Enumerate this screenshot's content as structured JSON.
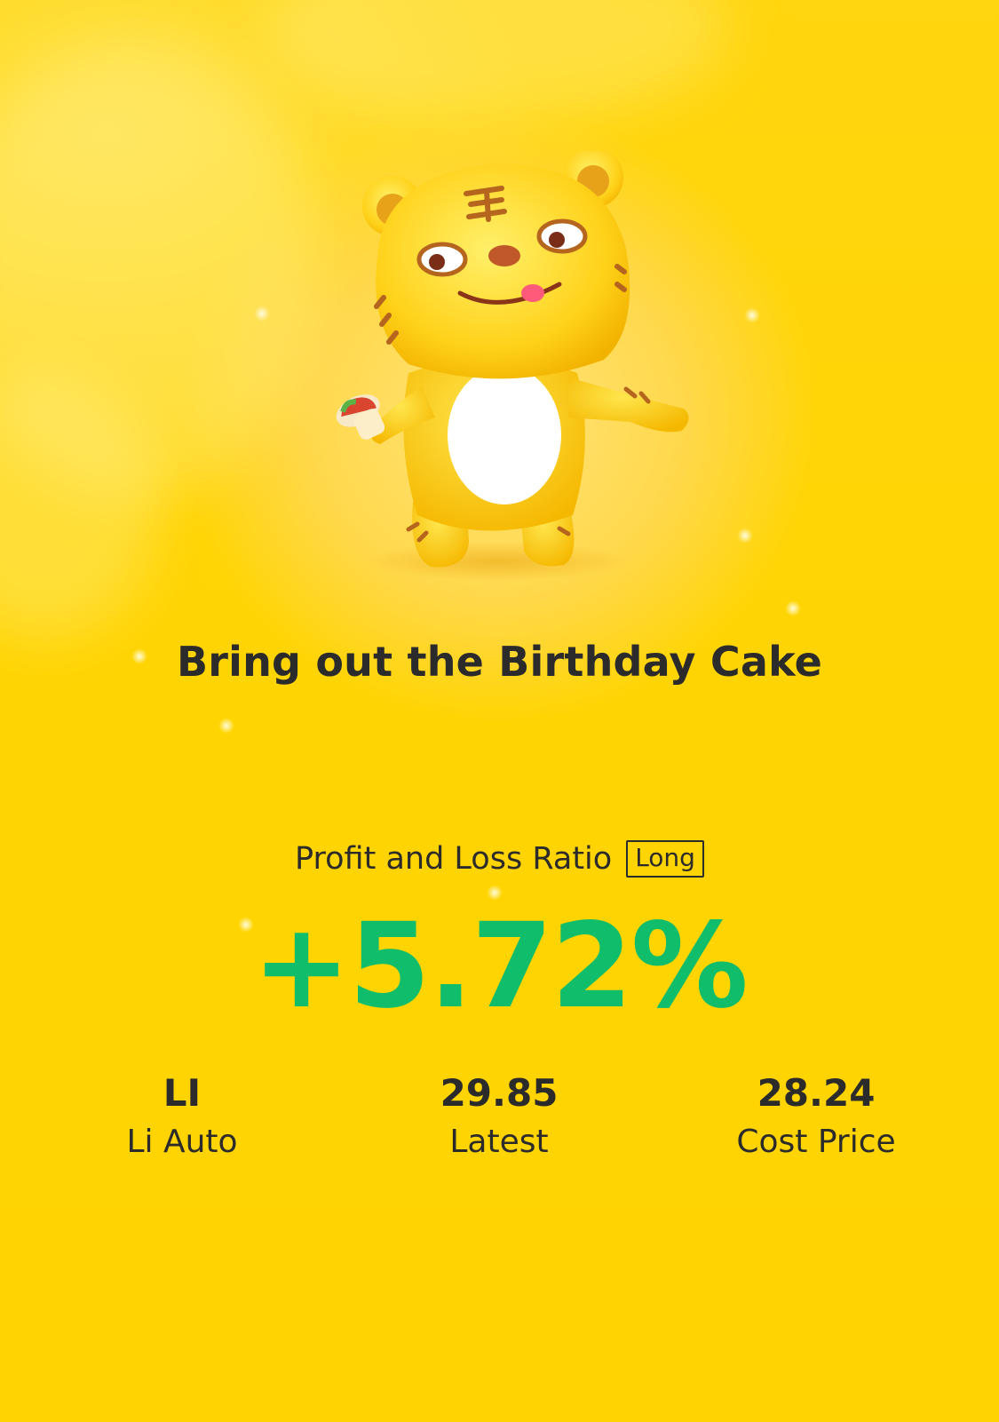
{
  "card": {
    "title": "Bring out the Birthday Cake",
    "mascot_icon": "tiger-mascot-icon"
  },
  "pl": {
    "label": "Profit and Loss Ratio",
    "tag": "Long",
    "value": "+5.72%",
    "value_color": "#0fbd6a"
  },
  "stats": [
    {
      "value": "LI",
      "label": "Li Auto"
    },
    {
      "value": "29.85",
      "label": "Latest"
    },
    {
      "value": "28.24",
      "label": "Cost Price"
    }
  ],
  "colors": {
    "background": "#ffd200",
    "text": "#2b2b2b",
    "profit_green": "#0fbd6a"
  }
}
